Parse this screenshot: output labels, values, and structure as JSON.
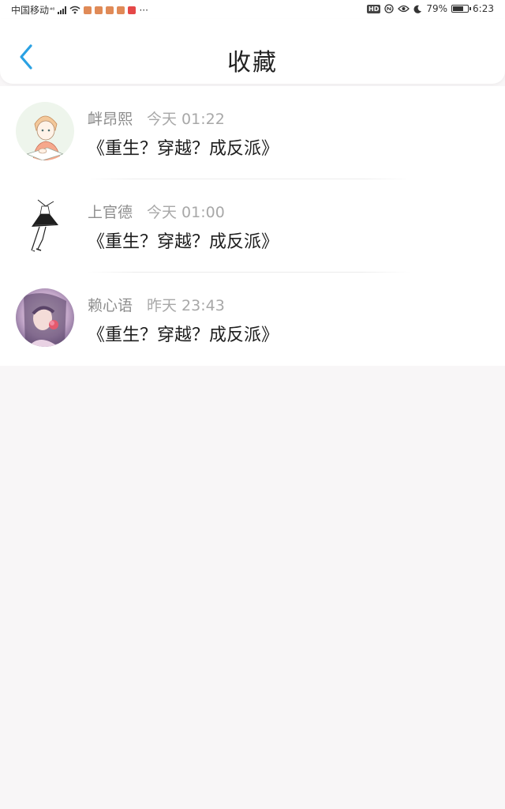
{
  "status_bar": {
    "carrier": "中国移动",
    "network_hint": "⁴⁶",
    "more": "···",
    "battery_level": "79%",
    "battery_fraction": 0.79,
    "time": "6:23"
  },
  "header": {
    "title": "收藏",
    "back_icon": "chevron-left-icon",
    "accent_color": "#2aa1e3"
  },
  "favorites": [
    {
      "name": "衅昂熙",
      "time": "今天 01:22",
      "title": "《重生？穿越？成反派》",
      "avatar": "boy-sketch-avatar"
    },
    {
      "name": "上官德",
      "time": "今天 01:00",
      "title": "《重生？穿越？成反派》",
      "avatar": "girl-skirt-sketch-avatar"
    },
    {
      "name": "赖心语",
      "time": "昨天 23:43",
      "title": "《重生？穿越？成反派》",
      "avatar": "girl-flower-avatar"
    }
  ]
}
